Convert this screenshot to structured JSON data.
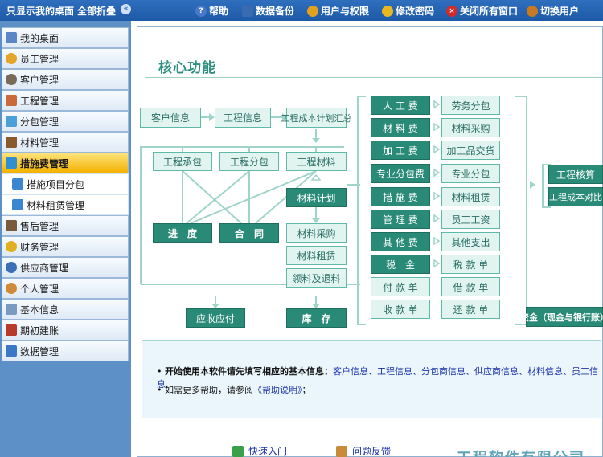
{
  "topbar": {
    "show_desktop": "只显示我的桌面",
    "collapse_all": "全部折叠",
    "help": "帮助",
    "backup": "数据备份",
    "users": "用户与权限",
    "password": "修改密码",
    "close_all": "关闭所有窗口",
    "switch_user": "切换用户"
  },
  "sidebar": {
    "items": [
      {
        "label": "我的桌面",
        "icon": "desktop-icon"
      },
      {
        "label": "员工管理",
        "icon": "employee-icon"
      },
      {
        "label": "客户管理",
        "icon": "customer-icon"
      },
      {
        "label": "工程管理",
        "icon": "house-icon"
      },
      {
        "label": "分包管理",
        "icon": "subcontract-icon"
      },
      {
        "label": "材料管理",
        "icon": "materials-icon"
      },
      {
        "label": "措施费管理",
        "icon": "measures-icon"
      },
      {
        "label": "措施项目分包",
        "icon": "folder-icon"
      },
      {
        "label": "材料租赁管理",
        "icon": "folder-icon"
      },
      {
        "label": "售后管理",
        "icon": "aftersales-icon"
      },
      {
        "label": "财务管理",
        "icon": "finance-icon"
      },
      {
        "label": "供应商管理",
        "icon": "supplier-icon"
      },
      {
        "label": "个人管理",
        "icon": "personal-icon"
      },
      {
        "label": "基本信息",
        "icon": "document-icon"
      },
      {
        "label": "期初建账",
        "icon": "book-icon"
      },
      {
        "label": "数据管理",
        "icon": "database-icon"
      }
    ]
  },
  "content": {
    "section_title": "核心功能",
    "flow": {
      "customer_info": "客户信息",
      "project_info": "工程信息",
      "cost_plan": "工程成本计划汇总",
      "contract": "工程承包",
      "subcontract": "工程分包",
      "project_material": "工程材料",
      "material_plan": "材料计划",
      "progress": "进　度",
      "contract_doc": "合　同",
      "material_purchase": "材料采购",
      "material_rent": "材料租赁",
      "material_pick": "领料及退料",
      "receivable": "应收应付",
      "inventory": "库　存",
      "labor_fee": "人 工 费",
      "material_fee": "材 料 费",
      "processing_fee": "加 工 费",
      "pro_sub_fee": "专业分包费",
      "measure_fee": "措 施 费",
      "mgmt_fee": "管 理 费",
      "other_fee": "其 他 费",
      "tax": "税　金",
      "payment_doc": "付 款 单",
      "receipt_doc": "收 款 单",
      "labor_sub": "劳务分包",
      "mat_purchase2": "材料采购",
      "processed_goods": "加工品交货",
      "pro_sub": "专业分包",
      "mat_rent2": "材料租赁",
      "staff_wage": "员工工资",
      "other_expense": "其他支出",
      "tax_doc": "税 款 单",
      "loan_doc": "借 款 单",
      "repay_doc": "还 款 单",
      "project_settle": "工程核算",
      "cost_compare": "工程成本对比",
      "funds": "资金（现金与银行账）"
    },
    "info": {
      "line1_bold": "开始使用本软件请先填写相应的基本信息：",
      "line1_links": "客户信息、工程信息、分包商信息、供应商信息、材料信息、员工信息",
      "line1_end": ".",
      "line2_prefix": "如需更多帮助，请参阅",
      "line2_link": "《帮助说明》",
      "line2_end": "；"
    },
    "bottom": {
      "quick_start": "快速入门",
      "feedback": "问题反馈",
      "company": "工程软件有限公司"
    }
  }
}
